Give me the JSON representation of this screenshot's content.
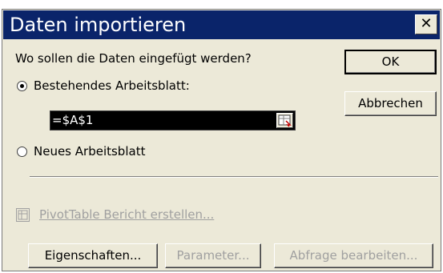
{
  "dialog": {
    "title": "Daten importieren",
    "close_label": "✕",
    "prompt": "Wo sollen die Daten eingefügt werden?",
    "options": [
      {
        "label": "Bestehendes Arbeitsblatt:",
        "checked": true
      },
      {
        "label": "Neues Arbeitsblatt",
        "checked": false
      }
    ],
    "reference_value": "=$A$1",
    "ok_label": "OK",
    "cancel_label": "Abbrechen",
    "pivot_label": "PivotTable Bericht erstellen...",
    "buttons": {
      "properties": "Eigenschaften...",
      "parameters": "Parameter...",
      "edit_query": "Abfrage bearbeiten..."
    }
  },
  "colors": {
    "titlebar": "#0a246a",
    "face": "#ece9d8",
    "disabled_text": "#a0a0a0"
  },
  "icons": [
    "close-icon",
    "range-selector-icon",
    "pivot-table-icon"
  ]
}
